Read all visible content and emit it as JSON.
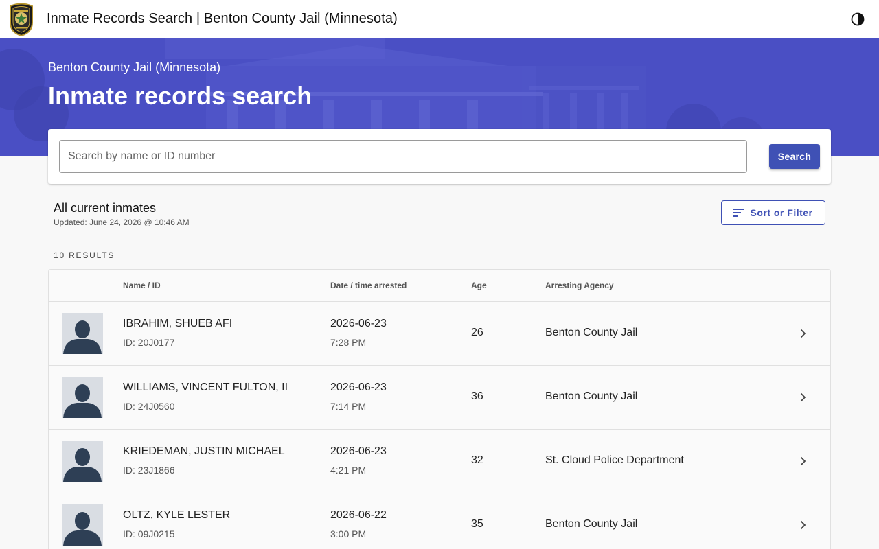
{
  "header": {
    "title": "Inmate Records Search | Benton County Jail (Minnesota)",
    "logo_icon": "sheriff-badge-icon",
    "theme_toggle_icon": "half-moon-icon"
  },
  "hero": {
    "subtitle": "Benton County Jail (Minnesota)",
    "title": "Inmate records search"
  },
  "search": {
    "placeholder": "Search by name or ID number",
    "value": "",
    "button_label": "Search"
  },
  "section": {
    "title": "All current inmates",
    "updated": "Updated: June 24, 2026 @ 10:46 AM",
    "filter_label": "Sort or Filter",
    "filter_icon": "sort-lines-icon",
    "results_count": "10 RESULTS"
  },
  "table": {
    "columns": {
      "name": "Name / ID",
      "date": "Date / time arrested",
      "age": "Age",
      "agency": "Arresting Agency"
    },
    "rows": [
      {
        "name": "IBRAHIM, SHUEB AFI",
        "id": "ID: 20J0177",
        "date": "2026-06-23",
        "time": "7:28 PM",
        "age": "26",
        "agency": "Benton County Jail"
      },
      {
        "name": "WILLIAMS, VINCENT FULTON, II",
        "id": "ID: 24J0560",
        "date": "2026-06-23",
        "time": "7:14 PM",
        "age": "36",
        "agency": "Benton County Jail"
      },
      {
        "name": "KRIEDEMAN, JUSTIN MICHAEL",
        "id": "ID: 23J1866",
        "date": "2026-06-23",
        "time": "4:21 PM",
        "age": "32",
        "agency": "St. Cloud Police Department"
      },
      {
        "name": "OLTZ, KYLE LESTER",
        "id": "ID: 09J0215",
        "date": "2026-06-22",
        "time": "3:00 PM",
        "age": "35",
        "agency": "Benton County Jail"
      }
    ]
  },
  "colors": {
    "primary": "#3f51b5",
    "hero": "#4a4fc4",
    "background": "#f8f8f8",
    "avatar_bg": "#d9dde3",
    "silhouette": "#2e3f55"
  }
}
